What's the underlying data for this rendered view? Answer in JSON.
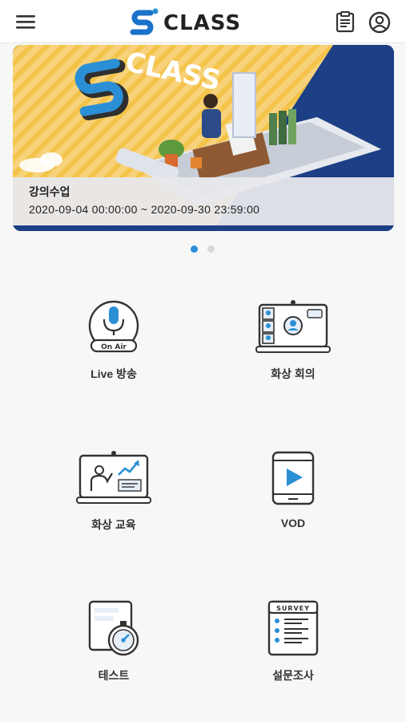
{
  "header": {
    "logo_text": "CLASS",
    "menu_icon": "hamburger-icon",
    "notice_icon": "clipboard-icon",
    "account_icon": "user-icon"
  },
  "banner": {
    "art_text": "CLASS",
    "title": "강의수업",
    "period": "2020-09-04 00:00:00 ~ 2020-09-30 23:59:00",
    "page_count": 2,
    "active_page": 1
  },
  "menu": {
    "live": {
      "label": "Live 방송",
      "badge": "On Air",
      "icon": "microphone-icon"
    },
    "meeting": {
      "label": "화상 회의",
      "icon": "video-conference-icon"
    },
    "education": {
      "label": "화상 교육",
      "icon": "online-lecture-icon"
    },
    "vod": {
      "label": "VOD",
      "icon": "play-icon"
    },
    "test": {
      "label": "테스트",
      "icon": "stopwatch-icon"
    },
    "survey": {
      "label": "설문조사",
      "badge": "SURVEY",
      "icon": "survey-icon"
    }
  },
  "colors": {
    "brand_blue": "#1a72c9",
    "accent_blue": "#2b8fd6",
    "navy": "#1c3f86",
    "banner_yellow": "#f4c44a",
    "icon_stroke": "#3a3a3a"
  }
}
